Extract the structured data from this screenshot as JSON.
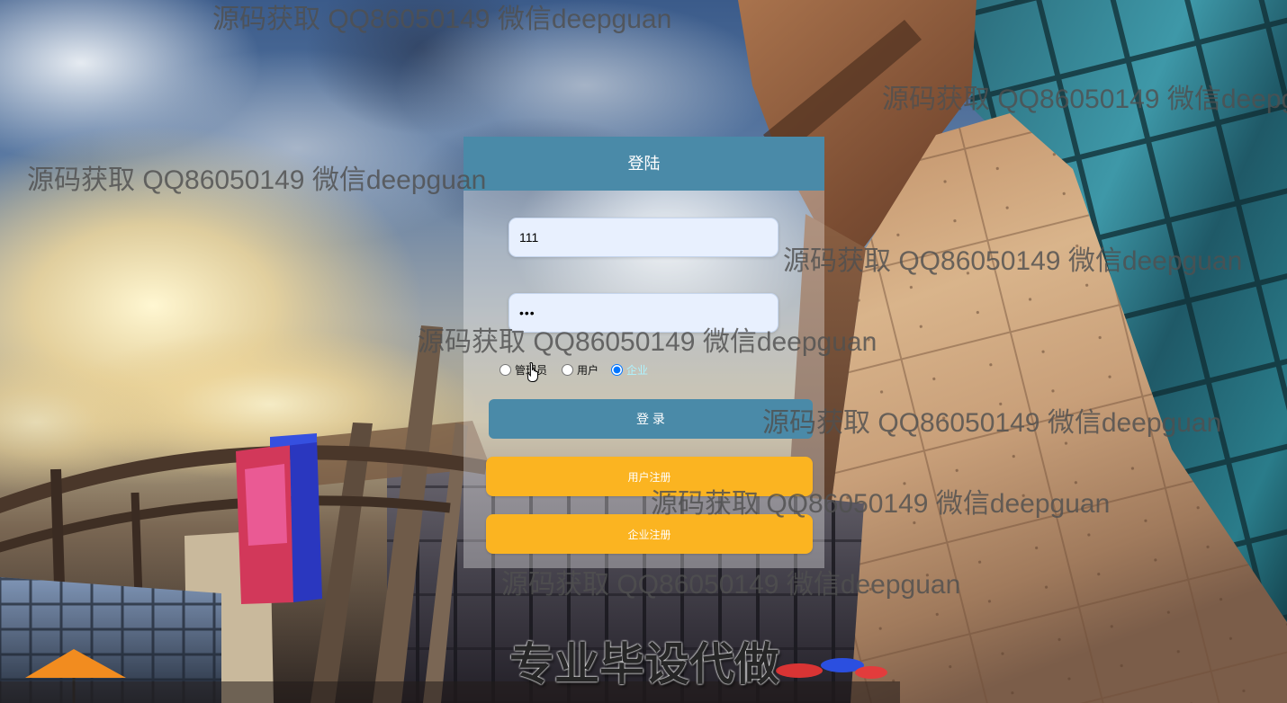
{
  "watermark": {
    "text": "源码获取 QQ86050149 微信deepguan"
  },
  "login_panel": {
    "header": "登陆",
    "username": {
      "value": "111"
    },
    "password": {
      "value": "•••"
    },
    "roles": [
      {
        "label": "管理员",
        "checked": false
      },
      {
        "label": "用户",
        "checked": false
      },
      {
        "label": "企业",
        "checked": true
      }
    ],
    "login_button": "登 录",
    "register_user_button": "用户注册",
    "register_company_button": "企业注册"
  },
  "banner": {
    "text": "专业毕设代做"
  },
  "cursor": {
    "icon": "hand-pointer-icon"
  },
  "colors": {
    "header": "#4a8aa8",
    "login_button": "#4a8aa8",
    "register_button": "#fbb421",
    "input_background": "#e8f0fe",
    "selected_role_label": "#aef3ff",
    "watermark": "#505050"
  }
}
